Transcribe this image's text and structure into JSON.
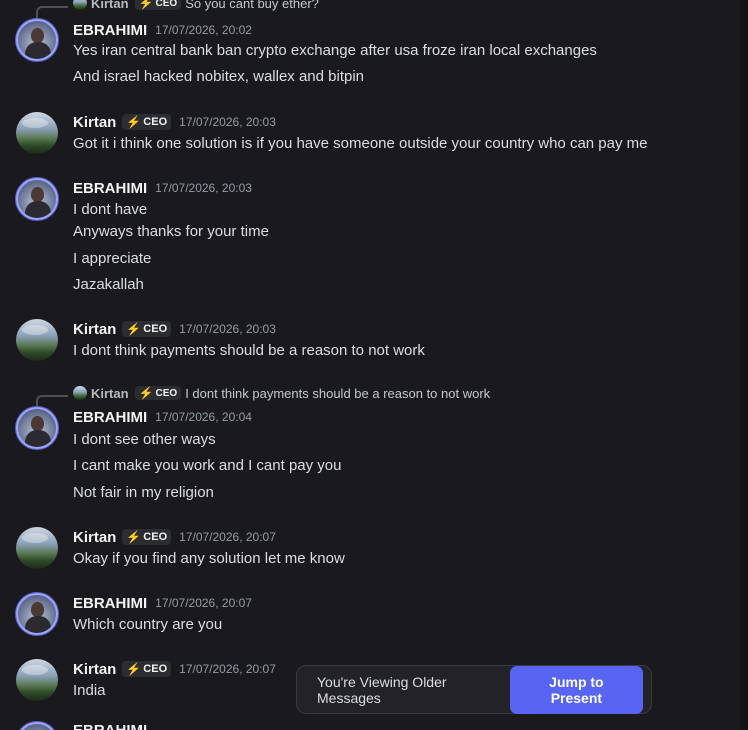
{
  "users": {
    "ebrahimi": {
      "name": "EBRAHIMI"
    },
    "kirtan": {
      "name": "Kirtan",
      "badge": "CEO"
    }
  },
  "top_reply": {
    "name": "Kirtan",
    "badge": "CEO",
    "text": "So you cant buy ether?"
  },
  "messages": [
    {
      "author": "EBRAHIMI",
      "time": "17/07/2026, 20:02",
      "lines": [
        "Yes iran central bank ban crypto exchange after usa froze iran local exchanges",
        "And israel hacked nobitex, wallex and bitpin"
      ]
    },
    {
      "author": "Kirtan",
      "badge": "CEO",
      "time": "17/07/2026, 20:03",
      "lines": [
        "Got it i think one solution is if you have someone outside your country who can pay me"
      ]
    },
    {
      "author": "EBRAHIMI",
      "time": "17/07/2026, 20:03",
      "lines": [
        "I dont have",
        "Anyways thanks for your time",
        "I appreciate",
        "Jazakallah"
      ]
    },
    {
      "author": "Kirtan",
      "badge": "CEO",
      "time": "17/07/2026, 20:03",
      "lines": [
        "I dont think payments should be  a reason to not work"
      ]
    },
    {
      "author": "EBRAHIMI",
      "time": "17/07/2026, 20:04",
      "reply": {
        "name": "Kirtan",
        "badge": "CEO",
        "text": "I dont think payments should be  a reason to not work"
      },
      "lines": [
        "I dont see other ways",
        "I cant make you work and I cant pay you",
        "Not fair in my religion"
      ]
    },
    {
      "author": "Kirtan",
      "badge": "CEO",
      "time": "17/07/2026, 20:07",
      "lines": [
        "Okay if you find any solution let me know"
      ]
    },
    {
      "author": "EBRAHIMI",
      "time": "17/07/2026, 20:07",
      "lines": [
        "Which country are you"
      ]
    },
    {
      "author": "Kirtan",
      "badge": "CEO",
      "time": "17/07/2026, 20:07",
      "lines": [
        "India"
      ]
    },
    {
      "author": "EBRAHIMI",
      "lines": []
    }
  ],
  "banner": {
    "text": "You're Viewing Older Messages",
    "button": "Jump to Present"
  },
  "colors": {
    "accent": "#5865f2",
    "background": "#1a1a1e",
    "badge_bolt": "#4aa3ff"
  },
  "icons": [
    "lightning-bolt-icon",
    "avatar"
  ]
}
